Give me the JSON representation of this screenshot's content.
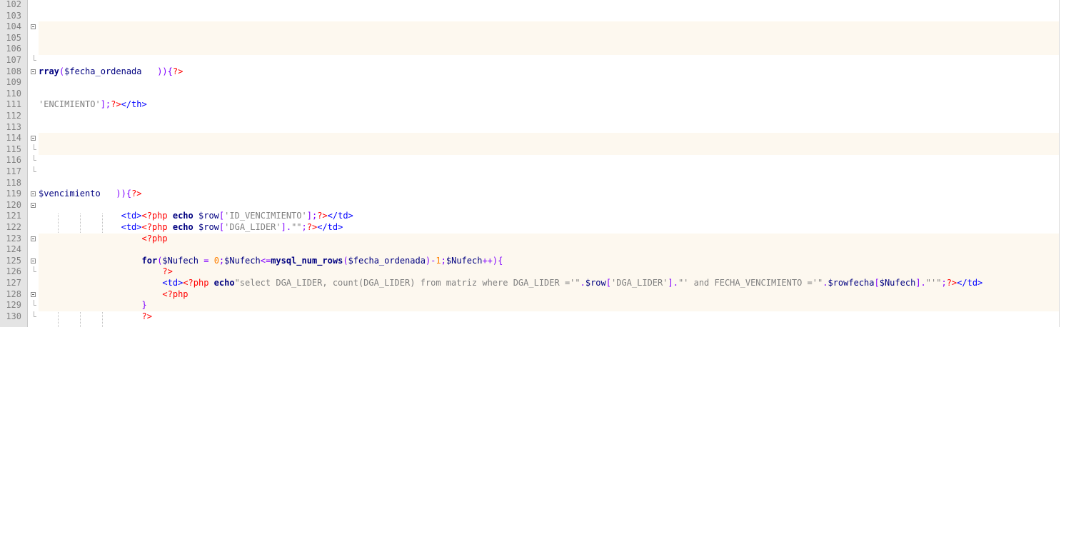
{
  "editor": {
    "lines": [
      {
        "n": "102",
        "fold": "none",
        "hl": false,
        "tokens": []
      },
      {
        "n": "103",
        "fold": "none",
        "hl": false,
        "tokens": []
      },
      {
        "n": "104",
        "fold": "box",
        "hl": true,
        "tokens": []
      },
      {
        "n": "105",
        "fold": "none",
        "hl": true,
        "tokens": []
      },
      {
        "n": "106",
        "fold": "none",
        "hl": true,
        "tokens": []
      },
      {
        "n": "107",
        "fold": "end",
        "hl": false,
        "tokens": []
      },
      {
        "n": "108",
        "fold": "box",
        "hl": false,
        "tokens": [
          {
            "t": "rray",
            "c": "kw"
          },
          {
            "t": "(",
            "c": "op"
          },
          {
            "t": "$fecha_ordenada",
            "c": "var"
          },
          {
            "t": "   ))",
            "c": "op"
          },
          {
            "t": "{",
            "c": "op"
          },
          {
            "t": "?>",
            "c": "php"
          }
        ]
      },
      {
        "n": "109",
        "fold": "none",
        "hl": false,
        "tokens": []
      },
      {
        "n": "110",
        "fold": "none",
        "hl": false,
        "tokens": []
      },
      {
        "n": "111",
        "fold": "none",
        "hl": false,
        "tokens": [
          {
            "t": "'ENCIMIENTO'",
            "c": "str"
          },
          {
            "t": "];",
            "c": "op"
          },
          {
            "t": "?>",
            "c": "php"
          },
          {
            "t": "</th>",
            "c": "tag"
          }
        ]
      },
      {
        "n": "112",
        "fold": "none",
        "hl": false,
        "tokens": []
      },
      {
        "n": "113",
        "fold": "none",
        "hl": false,
        "tokens": []
      },
      {
        "n": "114",
        "fold": "box",
        "hl": true,
        "tokens": []
      },
      {
        "n": "115",
        "fold": "end",
        "hl": true,
        "tokens": []
      },
      {
        "n": "116",
        "fold": "end",
        "hl": false,
        "tokens": []
      },
      {
        "n": "117",
        "fold": "end",
        "hl": false,
        "tokens": []
      },
      {
        "n": "118",
        "fold": "none",
        "hl": false,
        "tokens": []
      },
      {
        "n": "119",
        "fold": "box",
        "hl": false,
        "tokens": [
          {
            "t": "$vencimiento",
            "c": "var"
          },
          {
            "t": "   ))",
            "c": "op"
          },
          {
            "t": "{",
            "c": "op"
          },
          {
            "t": "?>",
            "c": "php"
          }
        ]
      },
      {
        "n": "120",
        "fold": "box",
        "hl": false,
        "tokens": []
      },
      {
        "n": "121",
        "fold": "none",
        "hl": false,
        "tokens": [
          {
            "t": "                ",
            "c": ""
          },
          {
            "t": "<td>",
            "c": "tag"
          },
          {
            "t": "<?php",
            "c": "php"
          },
          {
            "t": " ",
            "c": ""
          },
          {
            "t": "echo",
            "c": "kw"
          },
          {
            "t": " ",
            "c": ""
          },
          {
            "t": "$row",
            "c": "var"
          },
          {
            "t": "[",
            "c": "op"
          },
          {
            "t": "'ID_VENCIMIENTO'",
            "c": "str"
          },
          {
            "t": "];",
            "c": "op"
          },
          {
            "t": "?>",
            "c": "php"
          },
          {
            "t": "</td>",
            "c": "tag"
          }
        ]
      },
      {
        "n": "122",
        "fold": "none",
        "hl": false,
        "tokens": [
          {
            "t": "                ",
            "c": ""
          },
          {
            "t": "<td>",
            "c": "tag"
          },
          {
            "t": "<?php",
            "c": "php"
          },
          {
            "t": " ",
            "c": ""
          },
          {
            "t": "echo",
            "c": "kw"
          },
          {
            "t": " ",
            "c": ""
          },
          {
            "t": "$row",
            "c": "var"
          },
          {
            "t": "[",
            "c": "op"
          },
          {
            "t": "'DGA_LIDER'",
            "c": "str"
          },
          {
            "t": "].",
            "c": "op"
          },
          {
            "t": "\"\"",
            "c": "str"
          },
          {
            "t": ";",
            "c": "op"
          },
          {
            "t": "?>",
            "c": "php"
          },
          {
            "t": "</td>",
            "c": "tag"
          }
        ]
      },
      {
        "n": "123",
        "fold": "box",
        "hl": true,
        "tokens": [
          {
            "t": "                    ",
            "c": ""
          },
          {
            "t": "<?php",
            "c": "php"
          }
        ]
      },
      {
        "n": "124",
        "fold": "none",
        "hl": true,
        "tokens": []
      },
      {
        "n": "125",
        "fold": "box",
        "hl": true,
        "tokens": [
          {
            "t": "                    ",
            "c": ""
          },
          {
            "t": "for",
            "c": "kw"
          },
          {
            "t": "(",
            "c": "op"
          },
          {
            "t": "$Nufech",
            "c": "var"
          },
          {
            "t": " = ",
            "c": "op"
          },
          {
            "t": "0",
            "c": "num"
          },
          {
            "t": ";",
            "c": "op"
          },
          {
            "t": "$Nufech",
            "c": "var"
          },
          {
            "t": "<=",
            "c": "op"
          },
          {
            "t": "mysql_num_rows",
            "c": "kw"
          },
          {
            "t": "(",
            "c": "op"
          },
          {
            "t": "$fecha_ordenada",
            "c": "var"
          },
          {
            "t": ")-",
            "c": "op"
          },
          {
            "t": "1",
            "c": "num"
          },
          {
            "t": ";",
            "c": "op"
          },
          {
            "t": "$Nufech",
            "c": "var"
          },
          {
            "t": "++){",
            "c": "op"
          }
        ]
      },
      {
        "n": "126",
        "fold": "end",
        "hl": true,
        "tokens": [
          {
            "t": "                        ",
            "c": ""
          },
          {
            "t": "?>",
            "c": "php"
          }
        ]
      },
      {
        "n": "127",
        "fold": "none",
        "hl": true,
        "tokens": [
          {
            "t": "                        ",
            "c": ""
          },
          {
            "t": "<td>",
            "c": "tag"
          },
          {
            "t": "<?php",
            "c": "php"
          },
          {
            "t": " ",
            "c": ""
          },
          {
            "t": "echo",
            "c": "kw"
          },
          {
            "t": "\"select DGA_LIDER, count(DGA_LIDER) from matriz where DGA_LIDER ='\"",
            "c": "str"
          },
          {
            "t": ".",
            "c": "op"
          },
          {
            "t": "$row",
            "c": "var"
          },
          {
            "t": "[",
            "c": "op"
          },
          {
            "t": "'DGA_LIDER'",
            "c": "str"
          },
          {
            "t": "].",
            "c": "op"
          },
          {
            "t": "\"' and FECHA_VENCIMIENTO ='\"",
            "c": "str"
          },
          {
            "t": ".",
            "c": "op"
          },
          {
            "t": "$rowfecha",
            "c": "var"
          },
          {
            "t": "[",
            "c": "op"
          },
          {
            "t": "$Nufech",
            "c": "var"
          },
          {
            "t": "].",
            "c": "op"
          },
          {
            "t": "\"'\"",
            "c": "str"
          },
          {
            "t": ";",
            "c": "op"
          },
          {
            "t": "?>",
            "c": "php"
          },
          {
            "t": "</td>",
            "c": "tag"
          }
        ]
      },
      {
        "n": "128",
        "fold": "box",
        "hl": true,
        "tokens": [
          {
            "t": "                        ",
            "c": ""
          },
          {
            "t": "<?php",
            "c": "php"
          }
        ]
      },
      {
        "n": "129",
        "fold": "end",
        "hl": true,
        "tokens": [
          {
            "t": "                    ",
            "c": ""
          },
          {
            "t": "}",
            "c": "op"
          }
        ]
      },
      {
        "n": "130",
        "fold": "end",
        "hl": false,
        "tokens": [
          {
            "t": "                    ",
            "c": ""
          },
          {
            "t": "?>",
            "c": "php"
          }
        ]
      }
    ]
  }
}
